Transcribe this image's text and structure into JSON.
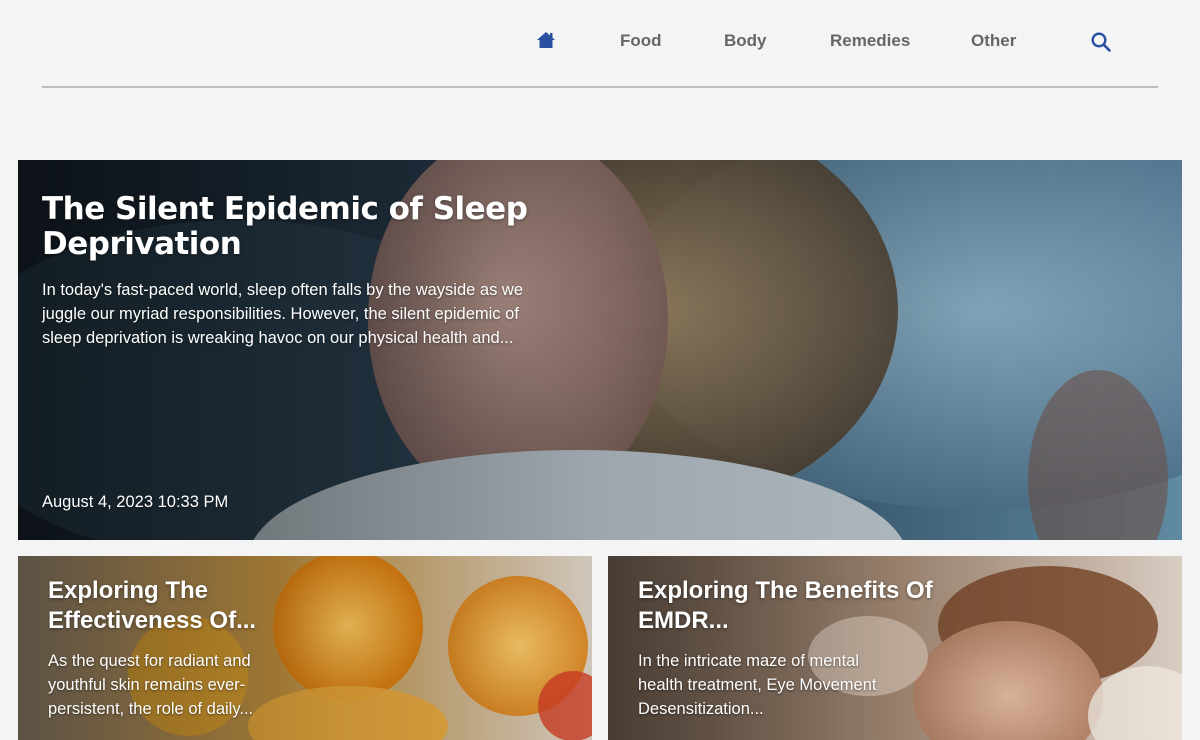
{
  "nav": {
    "home_icon": "home-icon",
    "links": [
      "Food",
      "Body",
      "Remedies",
      "Other"
    ],
    "search_icon": "search-icon",
    "accent": "#2a4ea0"
  },
  "hero": {
    "title": "The Silent Epidemic of Sleep Deprivation",
    "excerpt": "In today's fast-paced world, sleep often falls by the wayside as we juggle our myriad responsibilities. However, the silent epidemic of sleep deprivation is wreaking havoc on our physical health and...",
    "date": "August 4, 2023 10:33 PM"
  },
  "cards": [
    {
      "title": "Exploring The Effectiveness Of...",
      "excerpt": "As the quest for radiant and youthful skin remains ever-persistent, the role of daily..."
    },
    {
      "title": "Exploring The Benefits Of EMDR...",
      "excerpt": "In the intricate maze of mental health treatment, Eye Movement Desensitization..."
    }
  ]
}
